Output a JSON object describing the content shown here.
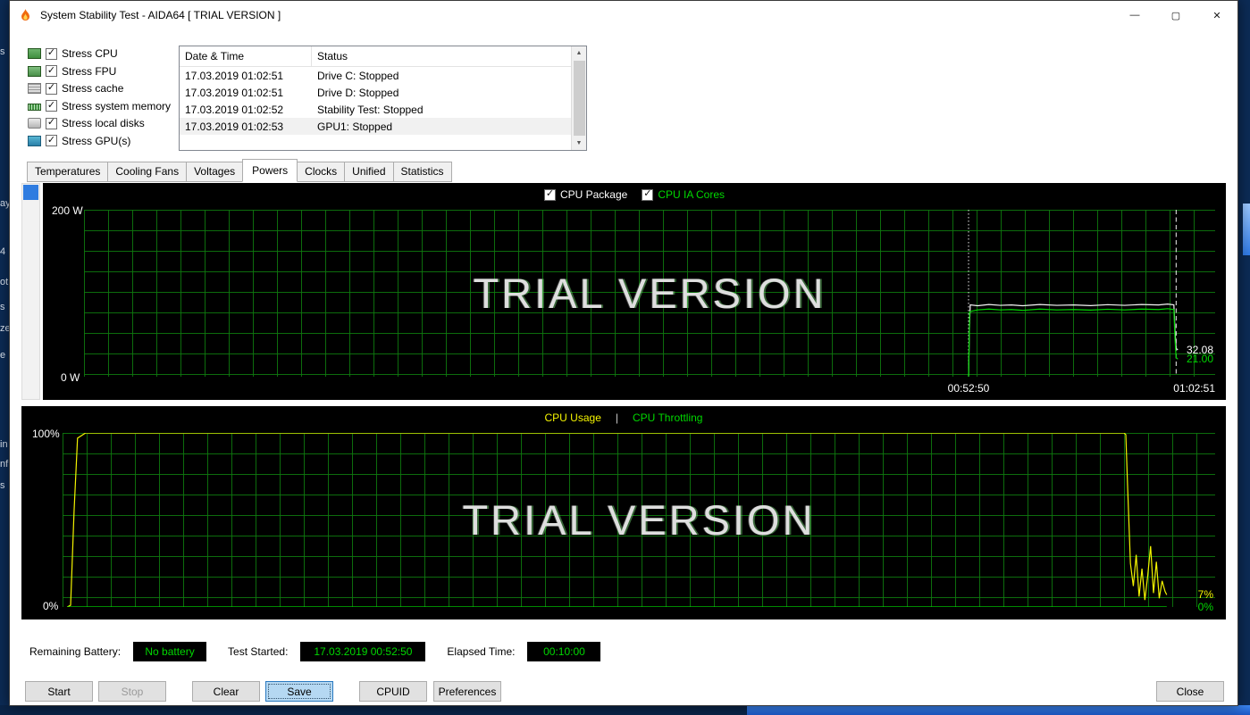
{
  "window": {
    "title": "System Stability Test - AIDA64  [ TRIAL VERSION ]",
    "controls": {
      "minimize": "—",
      "maximize": "▢",
      "close": "✕"
    }
  },
  "stress_options": [
    {
      "label": "Stress CPU",
      "checked": true
    },
    {
      "label": "Stress FPU",
      "checked": true
    },
    {
      "label": "Stress cache",
      "checked": true
    },
    {
      "label": "Stress system memory",
      "checked": true
    },
    {
      "label": "Stress local disks",
      "checked": true
    },
    {
      "label": "Stress GPU(s)",
      "checked": true
    }
  ],
  "log": {
    "columns": [
      "Date & Time",
      "Status"
    ],
    "rows": [
      {
        "time": "17.03.2019 01:02:51",
        "status": "Drive C: Stopped"
      },
      {
        "time": "17.03.2019 01:02:51",
        "status": "Drive D: Stopped"
      },
      {
        "time": "17.03.2019 01:02:52",
        "status": "Stability Test: Stopped"
      },
      {
        "time": "17.03.2019 01:02:53",
        "status": "GPU1: Stopped"
      }
    ]
  },
  "tabs": {
    "items": [
      "Temperatures",
      "Cooling Fans",
      "Voltages",
      "Powers",
      "Clocks",
      "Unified",
      "Statistics"
    ],
    "active": "Powers"
  },
  "chart_data": [
    {
      "type": "line",
      "ymax": 200,
      "ylabel_top": "200 W",
      "ylabel_bottom": "0 W",
      "watermark": "TRIAL VERSION",
      "legend": [
        {
          "label": "CPU Package",
          "color": "#ffffff",
          "checkbox": true,
          "checked": true
        },
        {
          "label": "CPU IA Cores",
          "color": "#00d800",
          "checkbox": true,
          "checked": true
        }
      ],
      "x_ticks": [
        {
          "label": "00:52:50",
          "x": 0.782,
          "align": "center"
        },
        {
          "label": "01:02:51",
          "x": 1.0,
          "align": "right"
        }
      ],
      "vlines": [
        {
          "x": 0.782,
          "color": "#e8e8e8",
          "dash": "1.5,2.5"
        },
        {
          "x": 0.9655,
          "color": "#f0f0f0",
          "dash": "5,3.5"
        }
      ],
      "end_labels": [
        {
          "text": "32.08",
          "color": "#ffffff",
          "value": 32.08
        },
        {
          "text": "21.00",
          "color": "#00d800",
          "value": 21.0
        }
      ],
      "series": [
        {
          "name": "CPU Package",
          "color": "#f5f5f5",
          "points": [
            [
              0.782,
              0
            ],
            [
              0.7828,
              60
            ],
            [
              0.7835,
              86
            ],
            [
              0.79,
              85
            ],
            [
              0.8,
              86.5
            ],
            [
              0.81,
              85.5
            ],
            [
              0.82,
              86
            ],
            [
              0.83,
              85
            ],
            [
              0.845,
              86.5
            ],
            [
              0.86,
              85.5
            ],
            [
              0.875,
              86
            ],
            [
              0.89,
              85.2
            ],
            [
              0.905,
              86.3
            ],
            [
              0.92,
              85.5
            ],
            [
              0.935,
              86.5
            ],
            [
              0.95,
              86
            ],
            [
              0.958,
              87
            ],
            [
              0.9635,
              86
            ],
            [
              0.9645,
              55
            ],
            [
              0.9655,
              34
            ],
            [
              0.967,
              32
            ]
          ]
        },
        {
          "name": "CPU IA Cores",
          "color": "#00d800",
          "points": [
            [
              0.782,
              0
            ],
            [
              0.783,
              78
            ],
            [
              0.79,
              80
            ],
            [
              0.8,
              81
            ],
            [
              0.81,
              80
            ],
            [
              0.82,
              80.5
            ],
            [
              0.83,
              79.5
            ],
            [
              0.845,
              81
            ],
            [
              0.86,
              80
            ],
            [
              0.875,
              80.5
            ],
            [
              0.89,
              79.8
            ],
            [
              0.905,
              80.8
            ],
            [
              0.92,
              80
            ],
            [
              0.935,
              81
            ],
            [
              0.95,
              80.5
            ],
            [
              0.958,
              81.5
            ],
            [
              0.9635,
              80.5
            ],
            [
              0.9645,
              45
            ],
            [
              0.9655,
              23
            ],
            [
              0.967,
              21
            ]
          ]
        }
      ]
    },
    {
      "type": "line",
      "ymax": 100,
      "ylabel_top": "100%",
      "ylabel_bottom": "0%",
      "watermark": "TRIAL VERSION",
      "legend": [
        {
          "label": "CPU Usage",
          "color": "#f4f400",
          "checkbox": false
        },
        {
          "label": "CPU Throttling",
          "color": "#00d800",
          "checkbox": false,
          "sep_before": "|"
        }
      ],
      "x_ticks": [],
      "vlines": [],
      "end_labels": [
        {
          "text": "7%",
          "color": "#f4f400",
          "value": 7
        },
        {
          "text": "0%",
          "color": "#00d800",
          "value": 0
        }
      ],
      "series": [
        {
          "name": "CPU Usage",
          "color": "#f4f400",
          "points": [
            [
              0.004,
              0
            ],
            [
              0.007,
              1
            ],
            [
              0.01,
              55
            ],
            [
              0.013,
              97
            ],
            [
              0.02,
              100
            ],
            [
              0.1,
              100
            ],
            [
              0.3,
              100
            ],
            [
              0.5,
              100
            ],
            [
              0.7,
              100
            ],
            [
              0.85,
              100
            ],
            [
              0.9,
              100
            ],
            [
              0.921,
              100
            ],
            [
              0.9225,
              99
            ],
            [
              0.924,
              70
            ],
            [
              0.9265,
              25
            ],
            [
              0.929,
              12
            ],
            [
              0.9315,
              30
            ],
            [
              0.934,
              6
            ],
            [
              0.9365,
              22
            ],
            [
              0.939,
              4
            ],
            [
              0.9415,
              18
            ],
            [
              0.944,
              35
            ],
            [
              0.9465,
              8
            ],
            [
              0.949,
              26
            ],
            [
              0.9515,
              5
            ],
            [
              0.954,
              15
            ],
            [
              0.9565,
              9
            ],
            [
              0.958,
              7
            ]
          ]
        },
        {
          "name": "CPU Throttling",
          "color": "#00d800",
          "points": [
            [
              0.004,
              0
            ],
            [
              0.958,
              0
            ]
          ]
        }
      ]
    }
  ],
  "status_bar": {
    "battery_label": "Remaining Battery:",
    "battery_value": "No battery",
    "started_label": "Test Started:",
    "started_value": "17.03.2019 00:52:50",
    "elapsed_label": "Elapsed Time:",
    "elapsed_value": "00:10:00"
  },
  "buttons": {
    "start": "Start",
    "stop": "Stop",
    "clear": "Clear",
    "save": "Save",
    "cpuid": "CPUID",
    "preferences": "Preferences",
    "close": "Close"
  },
  "desktop": {
    "fragments": [
      "s",
      "ay",
      "4",
      "ot",
      "s",
      "ze",
      "e",
      "in",
      "nf",
      "s"
    ]
  }
}
